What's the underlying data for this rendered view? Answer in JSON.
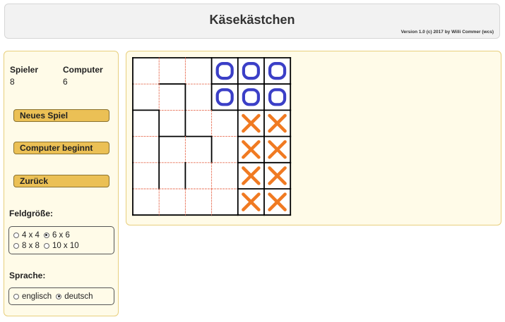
{
  "header": {
    "title": "Käsekästchen",
    "version": "Version 1.0 (c) 2017 by Willi Commer (wcs)"
  },
  "score": {
    "player_label": "Spieler",
    "player_value": "8",
    "computer_label": "Computer",
    "computer_value": "6"
  },
  "buttons": {
    "new_game": "Neues Spiel",
    "computer_starts": "Computer beginnt",
    "back": "Zurück"
  },
  "field_size": {
    "label": "Feldgröße:",
    "options": [
      "4 x 4",
      "6 x 6",
      "8 x 8",
      "10 x 10"
    ],
    "selected": "6 x 6"
  },
  "language": {
    "label": "Sprache:",
    "options": [
      "englisch",
      "deutsch"
    ],
    "selected": "deutsch"
  },
  "board": {
    "size": 6,
    "colors": {
      "player_mark": "#3b3fc7",
      "computer_mark": "#f07a22",
      "drawn_line": "#000000",
      "open_line": "#e8735a"
    },
    "cells": [
      [
        "",
        "",
        "",
        "O",
        "O",
        "O"
      ],
      [
        "",
        "",
        "",
        "O",
        "O",
        "O"
      ],
      [
        "",
        "",
        "",
        "",
        "X",
        "X"
      ],
      [
        "",
        "",
        "",
        "",
        "X",
        "X"
      ],
      [
        "",
        "",
        "",
        "",
        "X",
        "X"
      ],
      [
        "",
        "",
        "",
        "",
        "X",
        "X"
      ]
    ],
    "horizontal_lines": [
      [
        1,
        1,
        1,
        1,
        1,
        1
      ],
      [
        0,
        1,
        0,
        1,
        1,
        1
      ],
      [
        1,
        0,
        0,
        1,
        1,
        1
      ],
      [
        0,
        1,
        1,
        0,
        1,
        1
      ],
      [
        0,
        0,
        0,
        0,
        1,
        1
      ],
      [
        0,
        0,
        0,
        0,
        1,
        1
      ],
      [
        1,
        1,
        1,
        1,
        1,
        1
      ]
    ],
    "vertical_lines": [
      [
        1,
        0,
        0,
        1,
        1,
        1,
        1
      ],
      [
        1,
        0,
        1,
        1,
        1,
        1,
        1
      ],
      [
        1,
        1,
        1,
        0,
        1,
        1,
        1
      ],
      [
        1,
        1,
        0,
        1,
        1,
        1,
        1
      ],
      [
        1,
        1,
        1,
        0,
        1,
        1,
        1
      ],
      [
        1,
        0,
        0,
        0,
        1,
        1,
        1
      ]
    ]
  }
}
